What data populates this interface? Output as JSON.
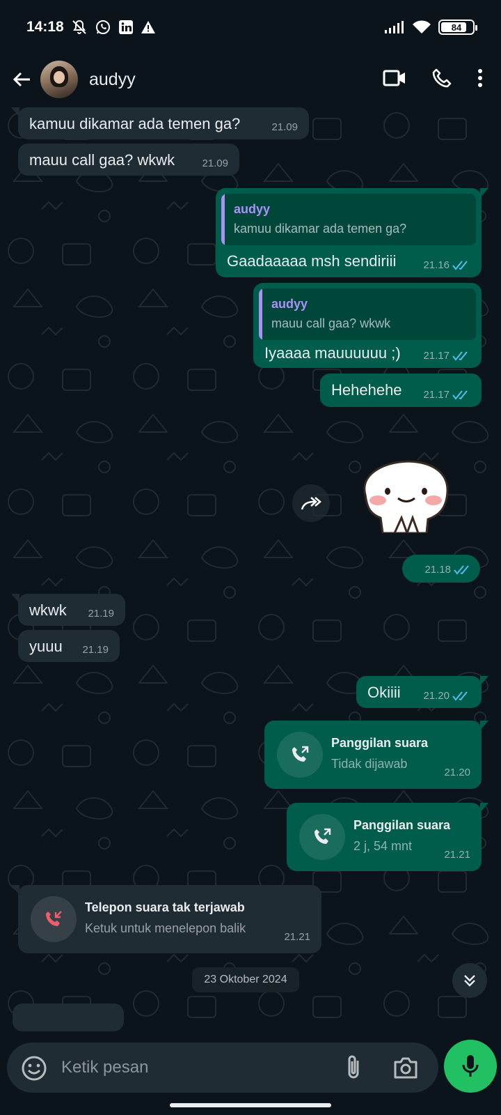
{
  "status_bar": {
    "time": "14:18",
    "battery": "84",
    "battery_level": 0.84,
    "icons": [
      "silent-bell-icon",
      "whatsapp-icon",
      "linkedin-icon",
      "warning-icon",
      "signal-icon",
      "wifi-icon",
      "battery-icon"
    ]
  },
  "header": {
    "contact_name": "audyy",
    "icons": [
      "back-arrow-icon",
      "video-call-icon",
      "voice-call-icon",
      "more-options-icon"
    ]
  },
  "messages": {
    "m1": {
      "text": "kamuu dikamar ada temen ga?",
      "time": "21.09"
    },
    "m2": {
      "text": "mauu call gaa? wkwk",
      "time": "21.09"
    },
    "m3": {
      "quote_name": "audyy",
      "quote_text": "kamuu dikamar ada temen ga?",
      "text": "Gaadaaaaa msh sendiriii",
      "time": "21.16"
    },
    "m4": {
      "quote_name": "audyy",
      "quote_text": "mauu call gaa? wkwk",
      "text": "Iyaaaa mauuuuuu ;)",
      "time": "21.17"
    },
    "m5": {
      "text": "Hehehehe",
      "time": "21.17"
    },
    "m6": {
      "time": "21.18"
    },
    "m7": {
      "text": "wkwk",
      "time": "21.19"
    },
    "m8": {
      "text": "yuuu",
      "time": "21.19"
    },
    "m9": {
      "text": "Okiiii",
      "time": "21.20"
    },
    "c1": {
      "title": "Panggilan suara",
      "subtitle": "Tidak dijawab",
      "time": "21.20"
    },
    "c2": {
      "title": "Panggilan suara",
      "subtitle": "2 j, 54 mnt",
      "time": "21.21"
    },
    "c3": {
      "title": "Telepon suara tak terjawab",
      "subtitle": "Ketuk untuk menelepon balik",
      "time": "21.21"
    }
  },
  "date_separator": "23 Oktober 2024",
  "input": {
    "placeholder": "Ketik pesan"
  },
  "colors": {
    "background": "#0b141a",
    "incoming_bubble": "#202c33",
    "outgoing_bubble": "#005c4b",
    "read_ticks": "#53bdeb",
    "mic_button": "#21c063",
    "missed_call": "#f15c6d",
    "quote_name": "#a892f5"
  }
}
